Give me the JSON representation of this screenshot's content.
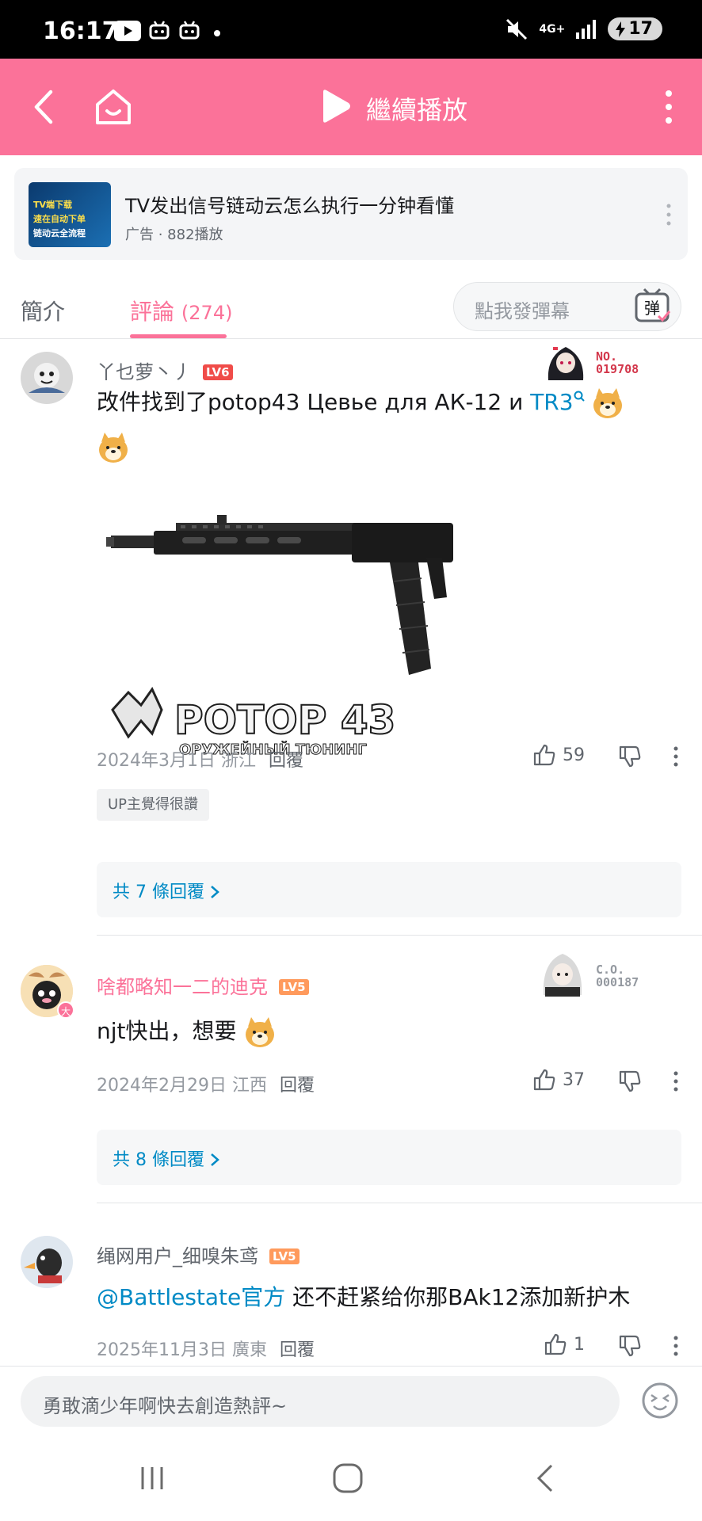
{
  "status_bar": {
    "time": "16:17",
    "network": "4G+",
    "battery": "17"
  },
  "header": {
    "title": "繼續播放"
  },
  "ad": {
    "title": "TV发出信号链动云怎么执行一分钟看懂",
    "meta": "广告 · 882播放",
    "thumb_line1": "TV端下载",
    "thumb_line2": "速在自动下单",
    "thumb_line3": "链动云全流程"
  },
  "tabs": {
    "intro": "簡介",
    "comments": "評論",
    "comments_count": "(274)",
    "danmaku_placeholder": "點我發彈幕",
    "danmaku_btn": "弹"
  },
  "comments": [
    {
      "username": "丫乜萝丶丿",
      "level": "LV6",
      "text_before_link": "改件找到了potop43  Цевье для АК-12 и ",
      "link": "TR3",
      "fan_no_label": "NO.",
      "fan_no": "019708",
      "image_brand": "POTOP 43",
      "image_tagline": "ОРУЖЕЙНЫЙ ТЮНИНГ",
      "date": "2024年3月1日",
      "location": "浙江",
      "reply_label": "回覆",
      "likes": "59",
      "up_tag": "UP主覺得很讚",
      "replies": "共 7 條回覆"
    },
    {
      "username": "啥都略知一二的迪克",
      "level": "LV5",
      "text": "njt快出，想要",
      "fan_no_label": "C.O.",
      "fan_no": "000187",
      "avatar_badge": "大",
      "date": "2024年2月29日",
      "location": "江西",
      "reply_label": "回覆",
      "likes": "37",
      "replies": "共 8 條回覆"
    },
    {
      "username": "绳网用户_细嗅朱鸢",
      "level": "LV5",
      "mention": "@Battlestate官方",
      "text": " 还不赶紧给你那BAk12添加新护木",
      "date": "2025年11月3日",
      "location": "廣東",
      "reply_label": "回覆",
      "likes": "1"
    }
  ],
  "input": {
    "placeholder": "勇敢滴少年啊快去創造熱評~"
  },
  "colors": {
    "brand_pink": "#fb7299",
    "link_blue": "#008ac5",
    "lv6": "#f04c49",
    "lv5": "#ff9a5c"
  }
}
